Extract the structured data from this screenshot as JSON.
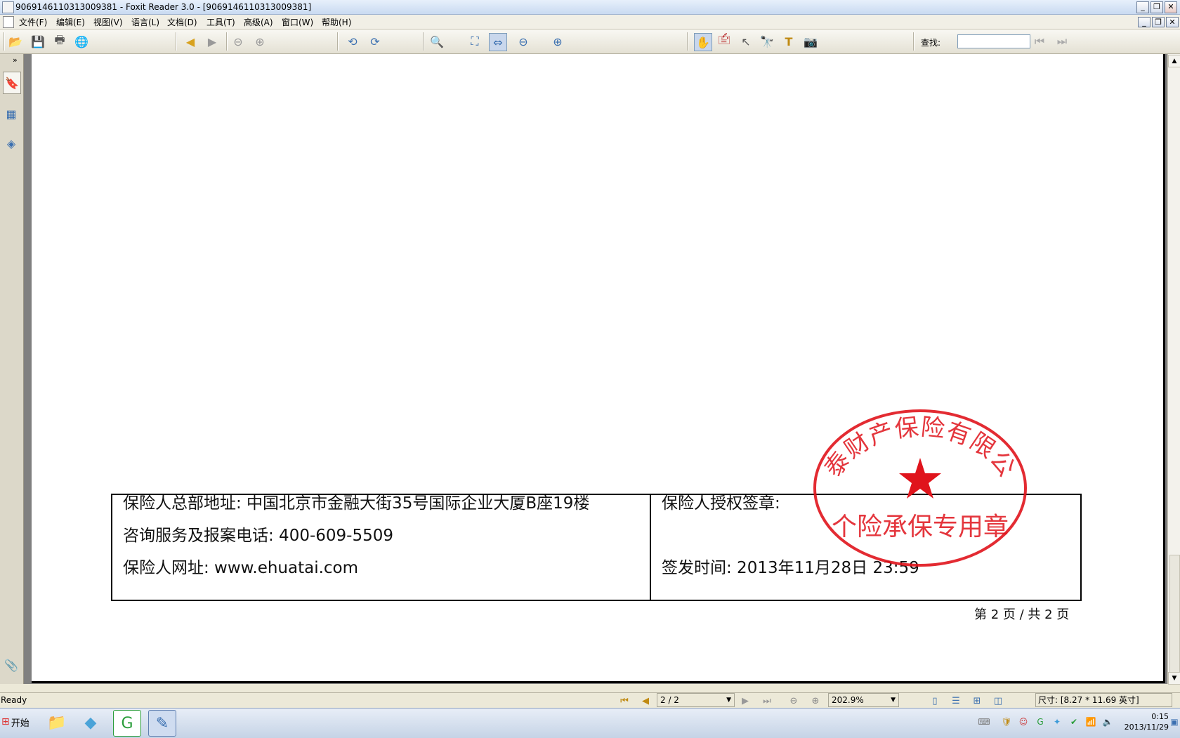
{
  "window": {
    "title": "9069146110313009381 - Foxit Reader 3.0 - [9069146110313009381]",
    "controls": [
      "_",
      "❐",
      "✕"
    ]
  },
  "menu": {
    "items": [
      "文件(F)",
      "编辑(E)",
      "视图(V)",
      "语言(L)",
      "文档(D)",
      "工具(T)",
      "高级(A)",
      "窗口(W)",
      "帮助(H)"
    ]
  },
  "toolbar": {
    "find_label": "查找:",
    "find_value": ""
  },
  "document": {
    "address_line": "保险人总部地址: 中国北京市金融大街35号国际企业大厦B座19楼",
    "phone_line": "咨询服务及报案电话: 400-609-5509",
    "website_line": "保险人网址: www.ehuatai.com",
    "signature_label": "保险人授权签章:",
    "issue_time": "签发时间: 2013年11月28日 23:59",
    "page_footer": "第 2 页 / 共 2 页"
  },
  "stamp": {
    "company": "华泰财产保险有限公司",
    "purpose": "个险承保专用章",
    "color": "#e0141c"
  },
  "status": {
    "ready": "Ready",
    "page_indicator": "2 / 2",
    "zoom": "202.9%",
    "size": "尺寸: [8.27 * 11.69 英寸]"
  },
  "taskbar": {
    "start_label": "开始",
    "clock_time": "0:15",
    "clock_date": "2013/11/29"
  }
}
